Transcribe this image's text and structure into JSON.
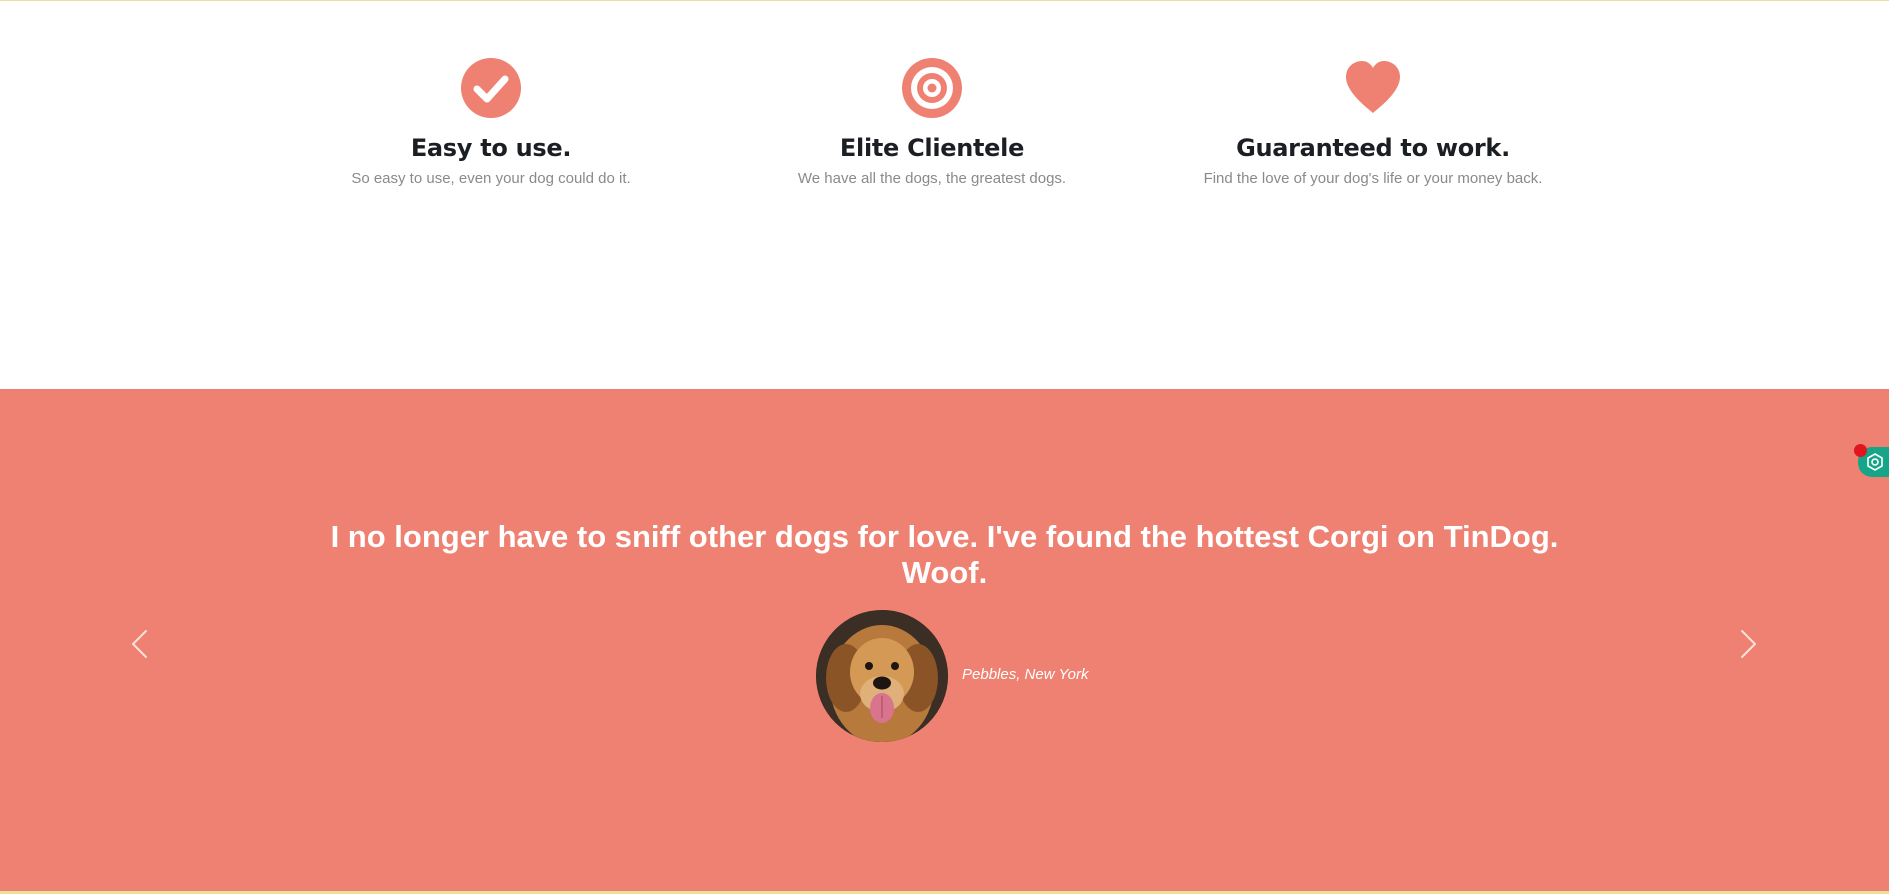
{
  "features": [
    {
      "icon": "check-circle-icon",
      "title": "Easy to use.",
      "description": "So easy to use, even your dog could do it."
    },
    {
      "icon": "bullseye-icon",
      "title": "Elite Clientele",
      "description": "We have all the dogs, the greatest dogs."
    },
    {
      "icon": "heart-icon",
      "title": "Guaranteed to work.",
      "description": "Find the love of your dog's life or your money back."
    }
  ],
  "testimonial": {
    "quote": "I no longer have to sniff other dogs for love. I've found the hottest Corgi on TinDog. Woof.",
    "attribution": "Pebbles, New York",
    "avatar": "golden-retriever-photo",
    "prev_icon": "chevron-left-icon",
    "next_icon": "chevron-right-icon"
  },
  "extension_widget": {
    "icon": "hexagon-gear-icon"
  },
  "colors": {
    "accent": "#ef8172",
    "heading": "#1b1f24",
    "muted_text": "#8a8a8a",
    "background": "#ffffff",
    "widget": "#17a589",
    "notification_dot": "#e0161c"
  }
}
